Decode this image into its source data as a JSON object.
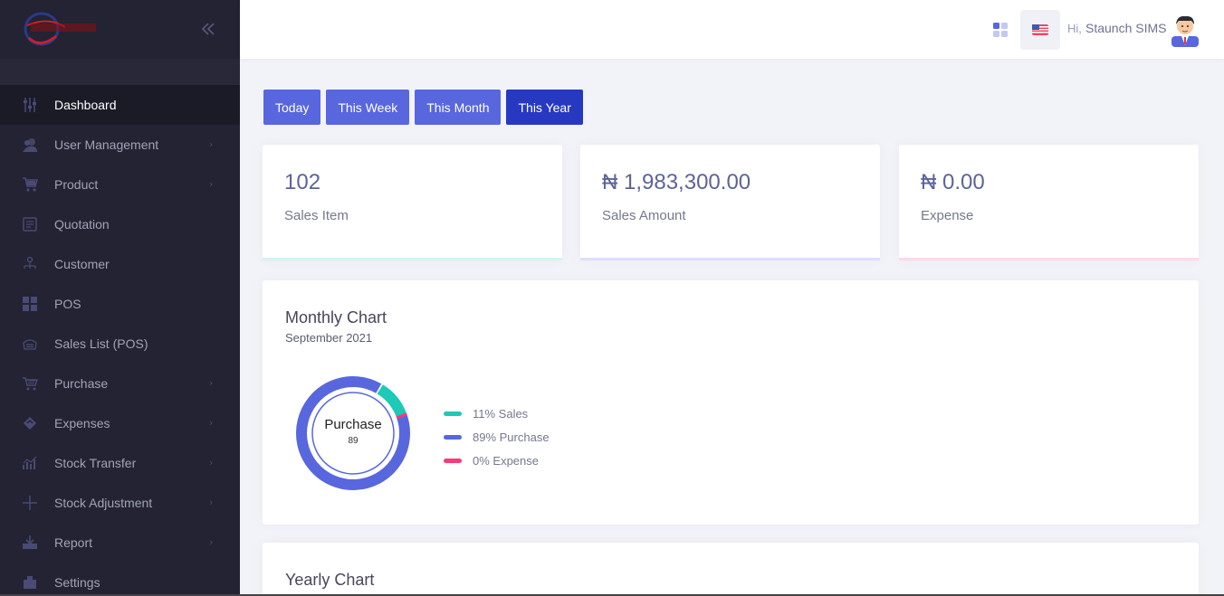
{
  "sidebar": {
    "collapse_icon": "double-chevron-left-icon",
    "items": [
      {
        "label": "Dashboard",
        "icon": "sliders-icon",
        "active": true,
        "has_arrow": false
      },
      {
        "label": "User Management",
        "icon": "users-icon",
        "active": false,
        "has_arrow": true
      },
      {
        "label": "Product",
        "icon": "cart-icon",
        "active": false,
        "has_arrow": true
      },
      {
        "label": "Quotation",
        "icon": "quotation-icon",
        "active": false,
        "has_arrow": false
      },
      {
        "label": "Customer",
        "icon": "customer-icon",
        "active": false,
        "has_arrow": false
      },
      {
        "label": "POS",
        "icon": "grid-icon",
        "active": false,
        "has_arrow": false
      },
      {
        "label": "Sales List (POS)",
        "icon": "sales-list-icon",
        "active": false,
        "has_arrow": false
      },
      {
        "label": "Purchase",
        "icon": "purchase-icon",
        "active": false,
        "has_arrow": true
      },
      {
        "label": "Expenses",
        "icon": "expenses-icon",
        "active": false,
        "has_arrow": true
      },
      {
        "label": "Stock Transfer",
        "icon": "chart-icon",
        "active": false,
        "has_arrow": true
      },
      {
        "label": "Stock Adjustment",
        "icon": "plus-icon",
        "active": false,
        "has_arrow": true
      },
      {
        "label": "Report",
        "icon": "download-icon",
        "active": false,
        "has_arrow": true
      },
      {
        "label": "Settings",
        "icon": "settings-icon",
        "active": false,
        "has_arrow": false
      }
    ]
  },
  "header": {
    "greeting": "Hi,",
    "username": "Staunch SIMS",
    "apps_icon": "apps-icon",
    "flag_icon": "us-flag-icon"
  },
  "filters": [
    {
      "label": "Today",
      "active": false
    },
    {
      "label": "This Week",
      "active": false
    },
    {
      "label": "This Month",
      "active": false
    },
    {
      "label": "This Year",
      "active": true
    }
  ],
  "stats": [
    {
      "value": "102",
      "label": "Sales Item",
      "color": "#1dc9b7"
    },
    {
      "value": "₦ 1,983,300.00",
      "label": "Sales Amount",
      "color": "#5867dd"
    },
    {
      "value": "₦ 0.00",
      "label": "Expense",
      "color": "#fd397a"
    }
  ],
  "monthly_chart": {
    "title": "Monthly Chart",
    "subtitle": "September 2021",
    "center_label": "Purchase",
    "center_value": "89",
    "legend": [
      {
        "label": "11% Sales",
        "color": "#1dc9b7"
      },
      {
        "label": "89% Purchase",
        "color": "#5867dd"
      },
      {
        "label": "0% Expense",
        "color": "#fd397a"
      }
    ]
  },
  "yearly_chart": {
    "title": "Yearly Chart"
  },
  "chart_data": {
    "type": "pie",
    "categories": [
      "Sales",
      "Purchase",
      "Expense"
    ],
    "values": [
      11,
      89,
      0
    ],
    "colors": [
      "#1dc9b7",
      "#5867dd",
      "#fd397a"
    ]
  }
}
